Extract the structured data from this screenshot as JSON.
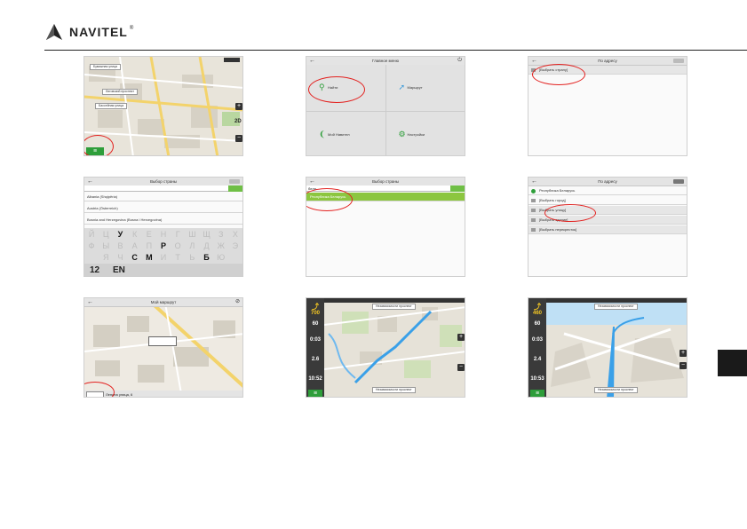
{
  "brand": {
    "name": "NAVITEL",
    "registered": "®"
  },
  "screens": {
    "map1": {
      "streets": [
        "Бумажная улица",
        "Лиговский проспект",
        "Бассейная улица"
      ],
      "zoom_plus": "+",
      "zoom_minus": "−",
      "mode": "2D",
      "menu_glyph": "≡"
    },
    "main_menu": {
      "title": "Главное меню",
      "items": [
        "Найти",
        "Маршрут",
        "Мой Навител",
        "Настройки"
      ]
    },
    "by_address_1": {
      "title": "По адресу",
      "rows": [
        "[Выбрать страну]"
      ]
    },
    "country_select": {
      "title": "Выбор страны",
      "rows": [
        "Albania (Shqipëria)",
        "Austria (Österreich)",
        "Bosnia and Herzegovina (Bosna i Hercegovina)"
      ],
      "keys": [
        "Й",
        "Ц",
        "У",
        "К",
        "Е",
        "Н",
        "Г",
        "Ш",
        "Щ",
        "З",
        "Х",
        "Ф",
        "Ы",
        "В",
        "А",
        "П",
        "Р",
        "О",
        "Л",
        "Д",
        "Ж",
        "Э",
        "",
        "Я",
        "Ч",
        "С",
        "М",
        "И",
        "Т",
        "Ь",
        "Б",
        "Ю",
        ""
      ],
      "active_keys": [
        "У",
        "Р",
        "С",
        "М",
        "Б"
      ],
      "numkey": "12",
      "langkey": "EN"
    },
    "country_search": {
      "title": "Выбор страны",
      "query": "бела",
      "result": "Республика Беларусь"
    },
    "by_address_2": {
      "title": "По адресу",
      "rows": [
        "Республика Беларусь",
        "[Выбрать город]",
        "[Выбрать улицу]",
        "[Выбрать здание]",
        "[Выбрать перекресток]"
      ]
    },
    "my_route": {
      "title": "Мой маршрут",
      "footer": "Ленина улица, 6"
    },
    "nav1": {
      "dist": "700",
      "speed": "60",
      "time1": "0:03",
      "dist2": "2.6",
      "clock": "10:52",
      "top_street": "Независимости проспект",
      "bottom_street": "Независимости проспект"
    },
    "nav2": {
      "dist": "460",
      "speed": "60",
      "time1": "0:03",
      "dist2": "2.4",
      "clock": "10:53",
      "top_street": "Независимости проспект",
      "bottom_street": "Независимости проспект"
    }
  },
  "colors": {
    "accent_green": "#2e9e3a",
    "highlight_red": "#e3211f",
    "route_blue": "#3aa0e8"
  }
}
